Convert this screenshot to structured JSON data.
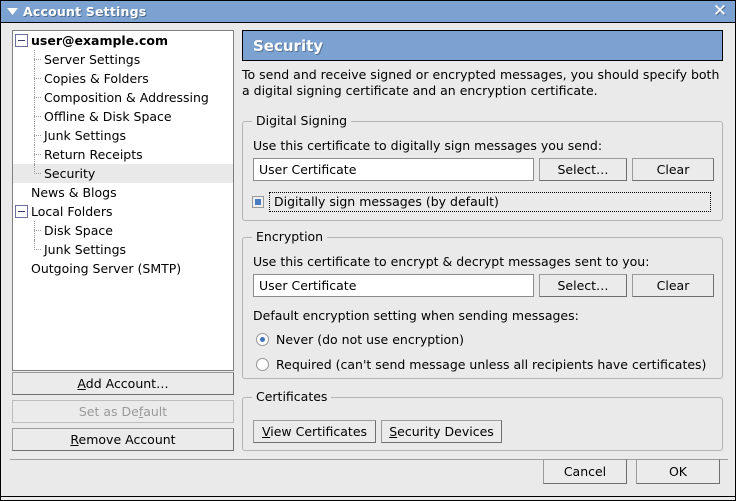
{
  "window": {
    "title": "Account Settings",
    "menu_icon": "caret-down-icon",
    "close_icon": "close-icon",
    "close_glyph": "✕"
  },
  "sidebar": {
    "tree": [
      {
        "label": "user@example.com",
        "level": 0,
        "expander": "minus",
        "bold": true,
        "selected": false
      },
      {
        "label": "Server Settings",
        "level": 1,
        "expander": "none",
        "bold": false,
        "selected": false
      },
      {
        "label": "Copies & Folders",
        "level": 1,
        "expander": "none",
        "bold": false,
        "selected": false
      },
      {
        "label": "Composition & Addressing",
        "level": 1,
        "expander": "none",
        "bold": false,
        "selected": false
      },
      {
        "label": "Offline & Disk Space",
        "level": 1,
        "expander": "none",
        "bold": false,
        "selected": false
      },
      {
        "label": "Junk Settings",
        "level": 1,
        "expander": "none",
        "bold": false,
        "selected": false
      },
      {
        "label": "Return Receipts",
        "level": 1,
        "expander": "none",
        "bold": false,
        "selected": false
      },
      {
        "label": "Security",
        "level": 1,
        "expander": "none",
        "bold": false,
        "selected": true
      },
      {
        "label": "News & Blogs",
        "level": 0,
        "expander": "none",
        "bold": false,
        "selected": false
      },
      {
        "label": "Local Folders",
        "level": 0,
        "expander": "minus",
        "bold": false,
        "selected": false
      },
      {
        "label": "Disk Space",
        "level": 1,
        "expander": "none",
        "bold": false,
        "selected": false
      },
      {
        "label": "Junk Settings",
        "level": 1,
        "expander": "none",
        "bold": false,
        "selected": false
      },
      {
        "label": "Outgoing Server (SMTP)",
        "level": 0,
        "expander": "none",
        "bold": false,
        "selected": false
      }
    ],
    "buttons": {
      "add_account": {
        "pre": "",
        "mnemonic": "A",
        "post": "dd Account…",
        "disabled": false
      },
      "set_as_default": {
        "pre": "Set as De",
        "mnemonic": "f",
        "post": "ault",
        "disabled": true
      },
      "remove_account": {
        "pre": "",
        "mnemonic": "R",
        "post": "emove Account",
        "disabled": false
      }
    }
  },
  "main": {
    "header_title": "Security",
    "description": "To send and receive signed or encrypted messages, you should specify both a digital signing certificate and an encryption certificate.",
    "digital_signing": {
      "group_title": "Digital Signing",
      "cert_label": "Use this certificate to digitally sign messages you send:",
      "cert_value": "User Certificate",
      "cert_placeholder": "",
      "select_button": "Select…",
      "clear_button": "Clear",
      "sign_by_default_label": "Digitally sign messages (by default)",
      "sign_by_default_checked": true,
      "sign_by_default_focused": true
    },
    "encryption": {
      "group_title": "Encryption",
      "cert_label": "Use this certificate to encrypt & decrypt messages sent to you:",
      "cert_value": "User Certificate",
      "cert_placeholder": "",
      "select_button": "Select…",
      "clear_button": "Clear",
      "default_setting_label": "Default encryption setting when sending messages:",
      "options": [
        {
          "label": "Never (do not use encryption)",
          "selected": true
        },
        {
          "label": "Required (can't send message unless all recipients have certificates)",
          "selected": false
        }
      ]
    },
    "certificates": {
      "group_title": "Certificates",
      "view_certificates": {
        "pre": "",
        "mnemonic": "V",
        "post": "iew Certificates"
      },
      "security_devices": {
        "pre": "",
        "mnemonic": "S",
        "post": "ecurity Devices"
      }
    }
  },
  "footer": {
    "cancel_label": "Cancel",
    "ok_label": "OK"
  },
  "colors": {
    "titlebar": "#7ba2d0",
    "header": "#7ba2d0",
    "window_bg": "#eaeaea",
    "selection": "#e9e9e9",
    "accent": "#4a7bbf"
  }
}
